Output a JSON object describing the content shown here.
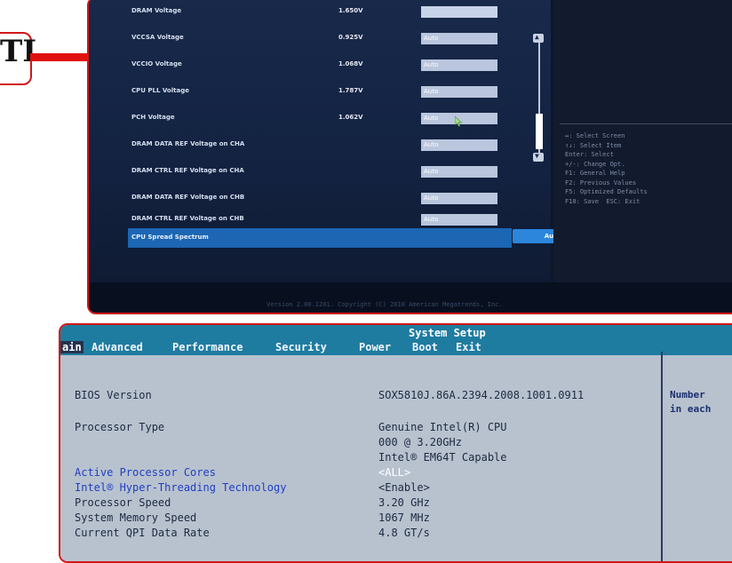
{
  "label": {
    "text": "TI"
  },
  "uefi": {
    "rows": [
      {
        "label": "DRAM Voltage",
        "value": "1.650V",
        "field": ""
      },
      {
        "label": "VCCSA Voltage",
        "value": "0.925V",
        "field": "Auto"
      },
      {
        "label": "VCCIO Voltage",
        "value": "1.068V",
        "field": "Auto"
      },
      {
        "label": "CPU PLL Voltage",
        "value": "1.787V",
        "field": "Auto"
      },
      {
        "label": "PCH Voltage",
        "value": "1.062V",
        "field": "Auto"
      },
      {
        "label": "DRAM DATA REF Voltage on CHA",
        "value": "",
        "field": "Auto"
      },
      {
        "label": "DRAM CTRL REF Voltage on CHA",
        "value": "",
        "field": "Auto"
      },
      {
        "label": "DRAM DATA REF Voltage on CHB",
        "value": "",
        "field": "Auto"
      },
      {
        "label": "DRAM CTRL REF Voltage on CHB",
        "value": "",
        "field": "Auto"
      }
    ],
    "selected": {
      "label": "CPU Spread Spectrum",
      "field": "Auto"
    },
    "help": "↔: Select Screen\n↑↓: Select Item\nEnter: Select\n+/-: Change Opt.\nF1: General Help\nF2: Previous Values\nF5: Optimized Defaults\nF10: Save  ESC: Exit",
    "footer": "Version 2.00.1201. Copyright (C) 2010 American Megatrends, Inc."
  },
  "bios": {
    "title": "System Setup",
    "menu": [
      "Main",
      "Advanced",
      "Performance",
      "Security",
      "Power",
      "Boot",
      "Exit"
    ],
    "main_visible": "ain",
    "rows": [
      {
        "label": "BIOS Version",
        "value": "SOX5810J.86A.2394.2008.1001.0911"
      },
      {
        "label": "Processor Type",
        "value": "Genuine Intel(R) CPU"
      },
      {
        "label": "",
        "value": "000  @ 3.20GHz"
      },
      {
        "label": "",
        "value": "Intel® EM64T Capable"
      },
      {
        "label": "Active Processor Cores",
        "value": "<ALL>"
      },
      {
        "label": "Intel® Hyper-Threading Technology",
        "value": "<Enable>"
      },
      {
        "label": "Processor Speed",
        "value": "3.20 GHz"
      },
      {
        "label": "System Memory Speed",
        "value": "1067 MHz"
      },
      {
        "label": "Current QPI Data Rate",
        "value": "4.8 GT/s"
      }
    ],
    "help": [
      "Number",
      "in each"
    ]
  }
}
